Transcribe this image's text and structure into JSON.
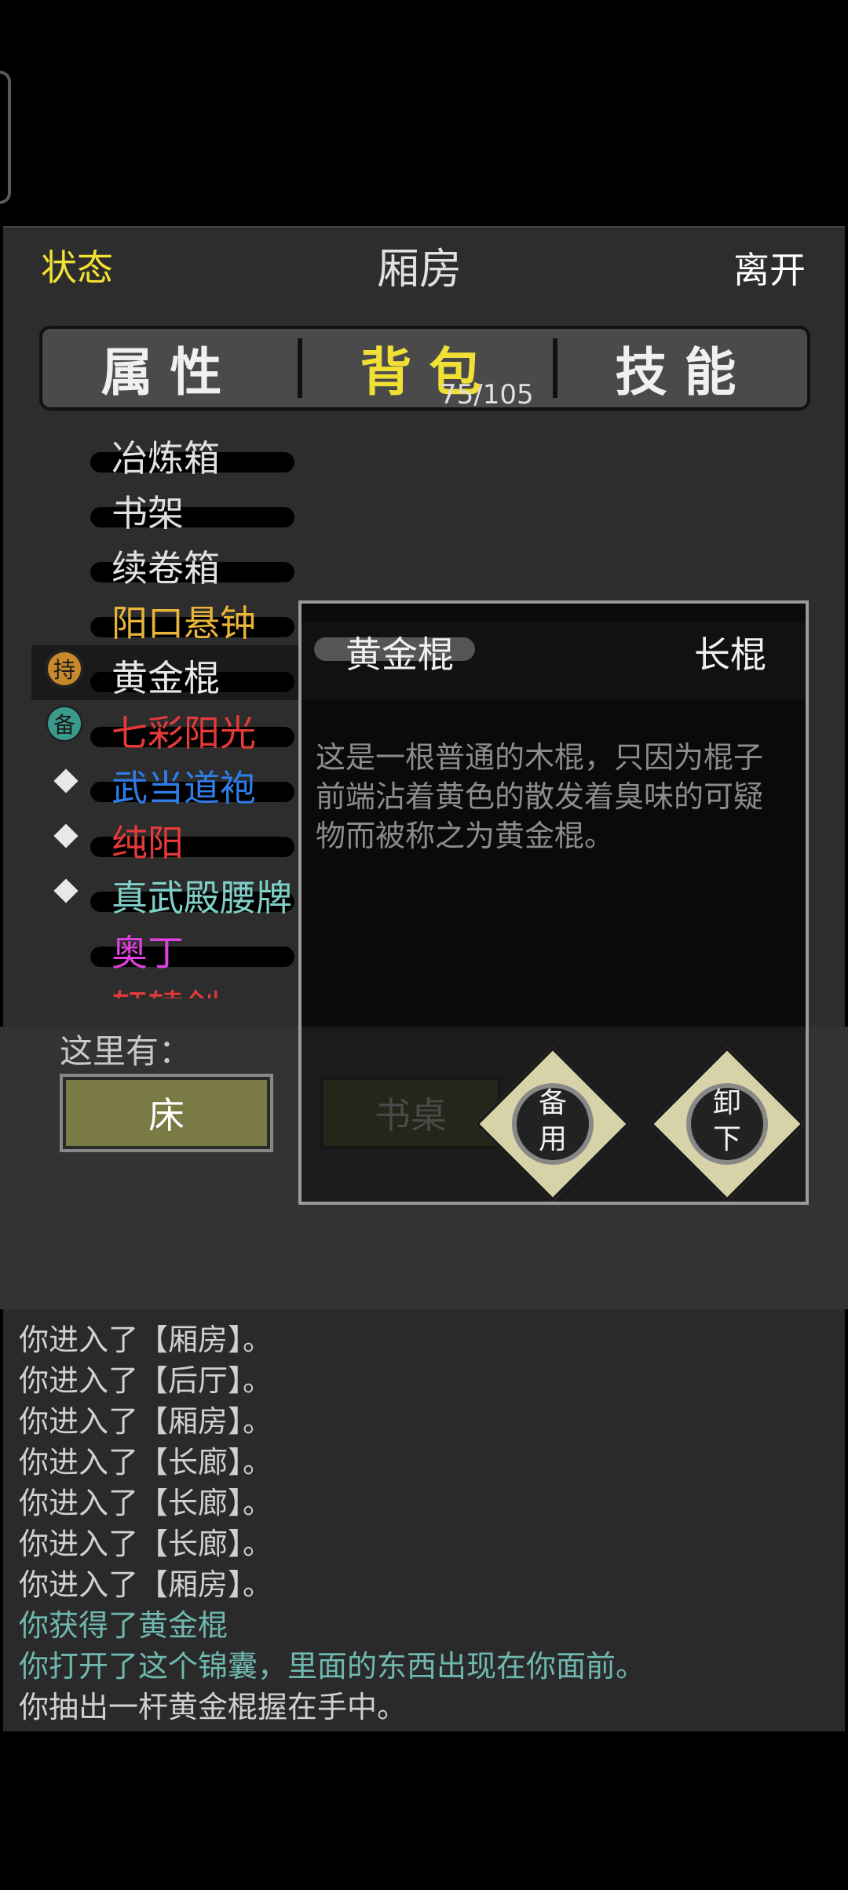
{
  "header": {
    "status": "状态",
    "room": "厢房",
    "leave": "离开"
  },
  "tabs": [
    {
      "label": "属性"
    },
    {
      "label": "背包"
    },
    {
      "label": "技能"
    }
  ],
  "bag_count": "75/105",
  "inventory": [
    {
      "name": "冶炼箱",
      "color": "#e0e0e0",
      "marker": ""
    },
    {
      "name": "书架",
      "color": "#e0e0e0",
      "marker": ""
    },
    {
      "name": "续卷箱",
      "color": "#e0e0e0",
      "marker": ""
    },
    {
      "name": "阳口悬钟",
      "color": "#e8b43a",
      "marker": ""
    },
    {
      "name": "黄金棍",
      "color": "#e8e8e8",
      "marker": "持",
      "marker_color": "#c8892c",
      "selected": true
    },
    {
      "name": "七彩阳光",
      "color": "#e53a3a",
      "marker": "备",
      "marker_color": "#3a9a8c"
    },
    {
      "name": "武当道袍",
      "color": "#2f7de6",
      "marker": "◆"
    },
    {
      "name": "纯阳",
      "color": "#e53a3a",
      "marker": "◆"
    },
    {
      "name": "真武殿腰牌",
      "color": "#7fd0c8",
      "marker": "◆"
    },
    {
      "name": "奥丁",
      "color": "#e040e0",
      "marker": ""
    },
    {
      "name": "轩辕剑",
      "color": "#e53a3a",
      "marker": ""
    }
  ],
  "detail": {
    "name": "黄金棍",
    "type": "长棍",
    "description": "这是一根普通的木棍，只因为棍子前端沾着黄色的散发着臭味的可疑物而被称之为黄金棍。",
    "actions": [
      "备用",
      "卸下"
    ]
  },
  "room": {
    "label": "这里有：",
    "objects": [
      "床",
      "书桌"
    ]
  },
  "log": [
    {
      "text": "你进入了【厢房】。",
      "color": "#d0d0d0"
    },
    {
      "text": "你进入了【后厅】。",
      "color": "#d0d0d0"
    },
    {
      "text": "你进入了【厢房】。",
      "color": "#d0d0d0"
    },
    {
      "text": "你进入了【长廊】。",
      "color": "#d0d0d0"
    },
    {
      "text": "你进入了【长廊】。",
      "color": "#d0d0d0"
    },
    {
      "text": "你进入了【长廊】。",
      "color": "#d0d0d0"
    },
    {
      "text": "你进入了【厢房】。",
      "color": "#d0d0d0"
    },
    {
      "text": "你获得了黄金棍",
      "color": "#6fb8b0"
    },
    {
      "text": "你打开了这个锦囊，里面的东西出现在你面前。",
      "color": "#6fb8b0"
    },
    {
      "text": "你抽出一杆黄金棍握在手中。",
      "color": "#d0d0d0"
    }
  ]
}
